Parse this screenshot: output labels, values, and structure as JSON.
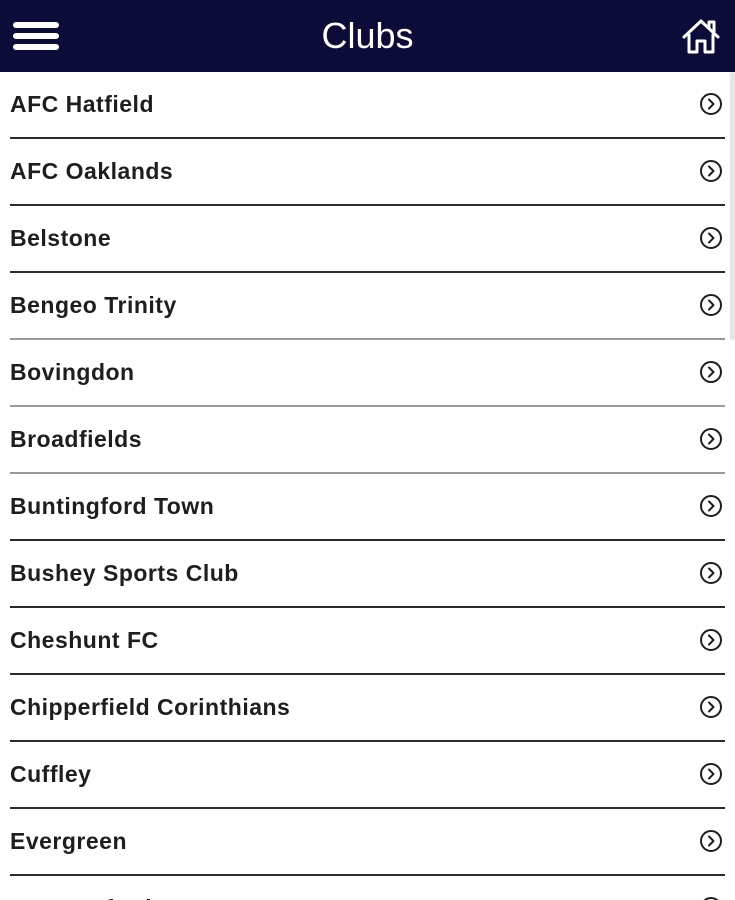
{
  "header": {
    "title": "Clubs",
    "menu_icon": "hamburger-menu-icon",
    "home_icon": "home-icon",
    "background": "#0c0c38"
  },
  "clubs": [
    {
      "label": "AFC Hatfield"
    },
    {
      "label": "AFC Oaklands"
    },
    {
      "label": "Belstone"
    },
    {
      "label": "Bengeo Trinity"
    },
    {
      "label": "Bovingdon"
    },
    {
      "label": "Broadfields"
    },
    {
      "label": "Buntingford Town"
    },
    {
      "label": "Bushey Sports Club"
    },
    {
      "label": "Cheshunt FC"
    },
    {
      "label": "Chipperfield Corinthians"
    },
    {
      "label": "Cuffley"
    },
    {
      "label": "Evergreen"
    },
    {
      "label": "FC Lonsford"
    }
  ]
}
